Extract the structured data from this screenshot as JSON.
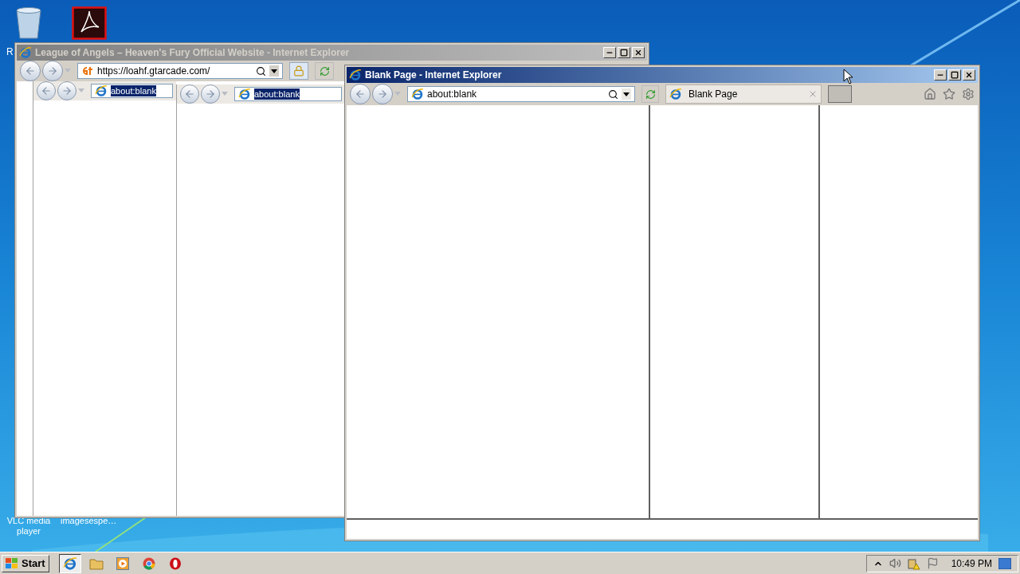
{
  "desktop": {
    "icons": [
      {
        "kind": "recycle",
        "label": "R"
      },
      {
        "kind": "pdf"
      },
      {
        "label": "VLC media player"
      },
      {
        "label": "imagesespe…"
      }
    ]
  },
  "windows": [
    {
      "title": "League of Angels – Heaven's Fury Official Website - Internet Explorer",
      "active": false,
      "address": "https://loahf.gtarcade.com/",
      "frames": [
        {
          "address": "about:blank"
        },
        {
          "address": "about:blank"
        }
      ]
    },
    {
      "title": "Blank Page - Internet Explorer",
      "active": true,
      "address": "about:blank",
      "tabs": [
        {
          "label": "Blank Page",
          "selected": true
        }
      ]
    }
  ],
  "taskbar": {
    "start": "Start",
    "apps": [
      {
        "kind": "ie",
        "selected": true
      },
      {
        "kind": "folder",
        "selected": false
      },
      {
        "kind": "media",
        "selected": false
      },
      {
        "kind": "chrome",
        "selected": false
      },
      {
        "kind": "opera",
        "selected": false
      }
    ],
    "clock": "10:49 PM"
  }
}
